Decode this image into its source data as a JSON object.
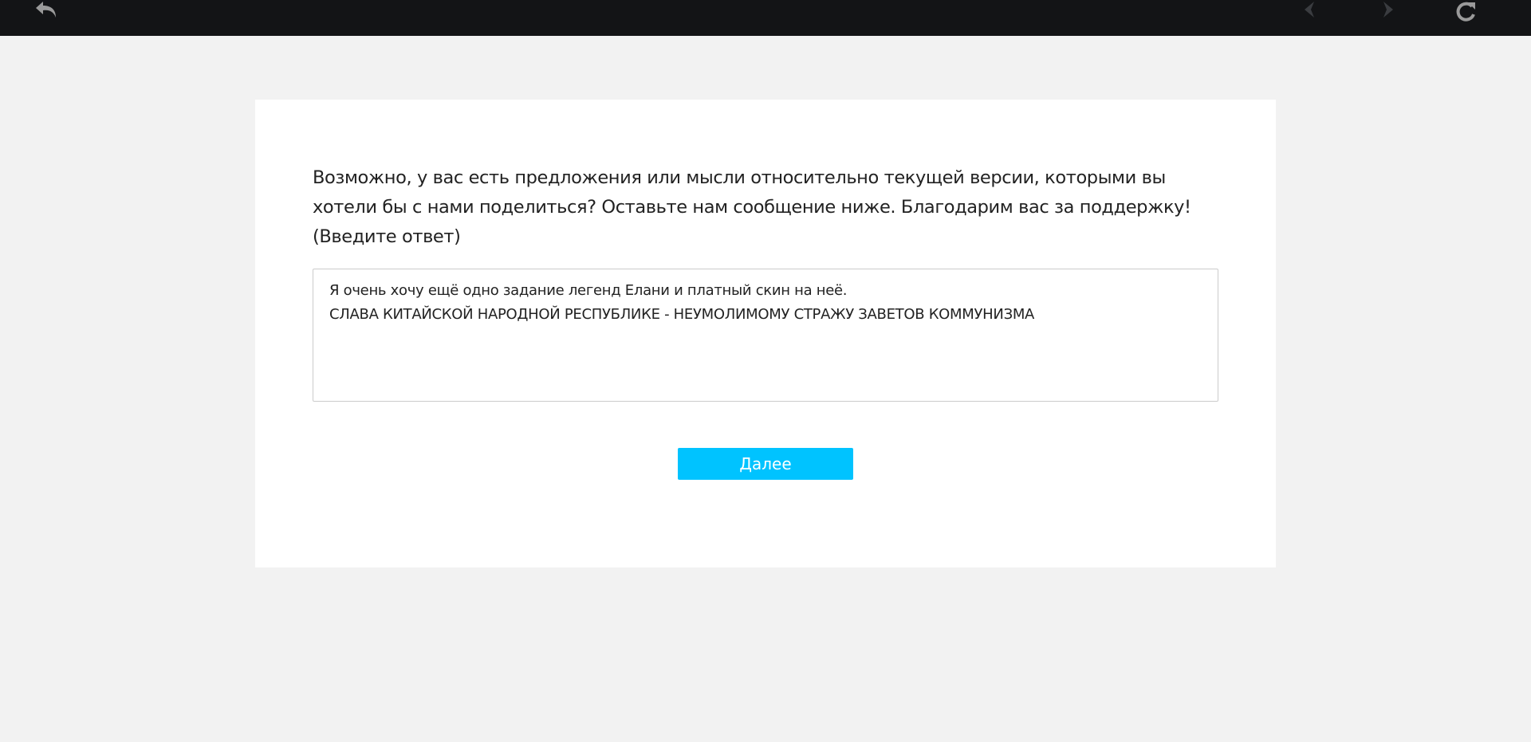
{
  "toolbar": {
    "back_icon": "undo-arrow-icon",
    "prev_icon": "prev-arrow-icon",
    "next_icon": "next-arrow-icon",
    "reload_icon": "reload-icon"
  },
  "survey": {
    "question": " Возможно, у вас есть предложения или мысли относительно текущей версии, которыми вы хотели бы с нами поделиться? Оставьте нам сообщение ниже. Благодарим вас за поддержку! (Введите ответ)",
    "answer_value": "Я очень хочу ещё одно задание легенд Елани и платный скин на неё.\nСЛАВА КИТАЙСКОЙ НАРОДНОЙ РЕСПУБЛИКЕ - НЕУМОЛИМОМУ СТРАЖУ ЗАВЕТОВ КОММУНИЗМА",
    "next_label": "Далее"
  },
  "colors": {
    "topbar": "#131416",
    "background": "#f2f2f2",
    "card": "#ffffff",
    "accent": "#00c3ff",
    "icon_active": "#9a9a9a",
    "icon_disabled": "#3a3c40"
  }
}
